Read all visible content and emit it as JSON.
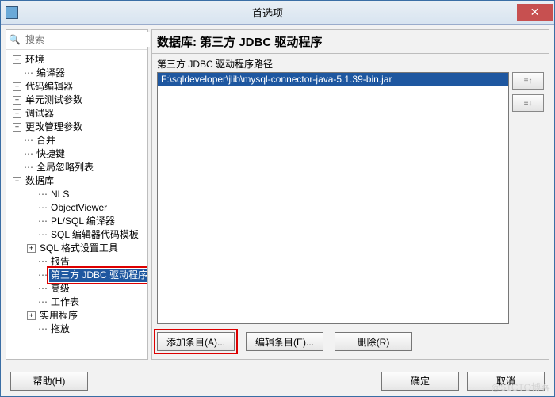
{
  "titlebar": {
    "title": "首选项",
    "close": "✕"
  },
  "search": {
    "placeholder": "搜索",
    "icon": "🔍"
  },
  "tree": {
    "top": [
      {
        "label": "环境",
        "type": "expand",
        "icon": "+"
      },
      {
        "label": "编译器",
        "type": "leaf"
      },
      {
        "label": "代码编辑器",
        "type": "expand",
        "icon": "+"
      },
      {
        "label": "单元测试参数",
        "type": "expand",
        "icon": "+"
      },
      {
        "label": "调试器",
        "type": "expand",
        "icon": "+"
      },
      {
        "label": "更改管理参数",
        "type": "expand",
        "icon": "+"
      },
      {
        "label": "合并",
        "type": "leaf"
      },
      {
        "label": "快捷键",
        "type": "leaf"
      },
      {
        "label": "全局忽略列表",
        "type": "leaf"
      }
    ],
    "db": {
      "label": "数据库",
      "icon": "−"
    },
    "db_children": [
      {
        "label": "NLS"
      },
      {
        "label": "ObjectViewer"
      },
      {
        "label": "PL/SQL 编译器"
      },
      {
        "label": "SQL 编辑器代码模板"
      },
      {
        "label": "SQL 格式设置工具",
        "expand": "+"
      },
      {
        "label": "报告"
      },
      {
        "label": "第三方 JDBC 驱动程序",
        "selected": true
      },
      {
        "label": "高级"
      },
      {
        "label": "工作表"
      },
      {
        "label": "实用程序",
        "expand": "+"
      },
      {
        "label": "拖放"
      }
    ]
  },
  "main": {
    "header": "数据库: 第三方 JDBC 驱动程序",
    "path_label": "第三方 JDBC 驱动程序路径",
    "items": [
      {
        "path": "F:\\sqldeveloper\\jlib\\mysql-connector-java-5.1.39-bin.jar",
        "selected": true
      }
    ],
    "reorder_up": "≡↑",
    "reorder_down": "≡↓",
    "btn_add": "添加条目(A)...",
    "btn_edit": "编辑条目(E)...",
    "btn_delete": "删除(R)"
  },
  "footer": {
    "help": "帮助(H)",
    "ok": "确定",
    "cancel": "取消"
  },
  "watermark": "@51CTO博客"
}
